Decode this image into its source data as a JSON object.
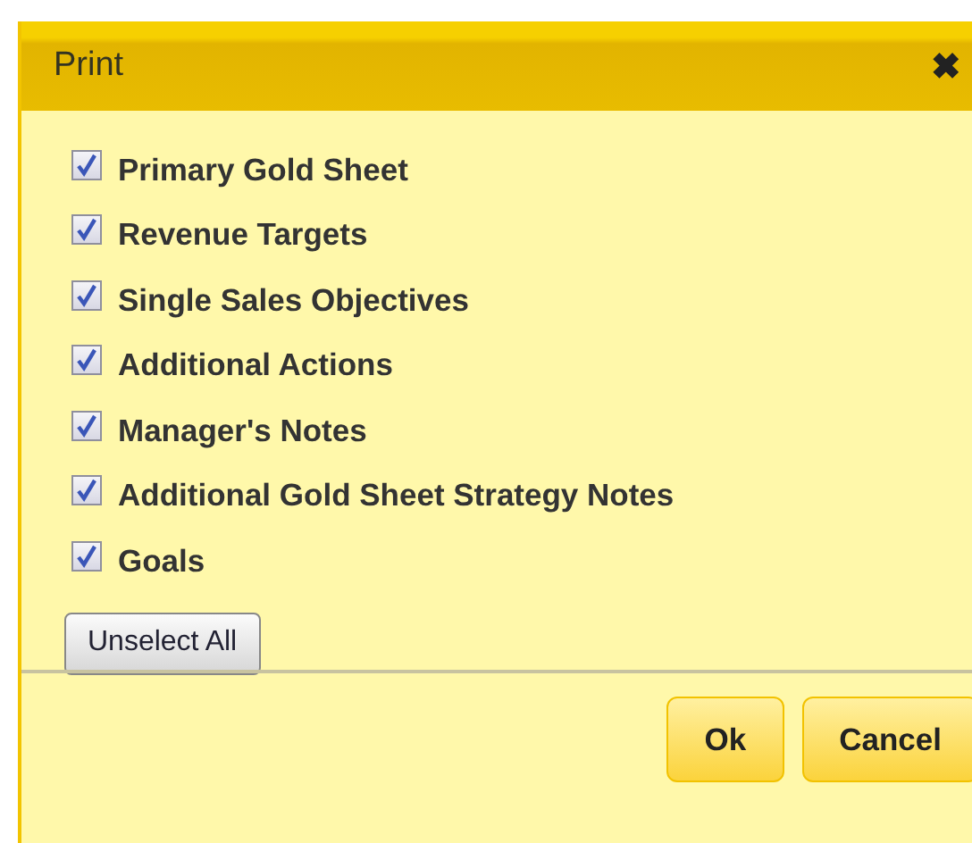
{
  "window": {
    "title": "Print",
    "close": "✖"
  },
  "options": [
    {
      "label": "Primary Gold Sheet",
      "checked": true
    },
    {
      "label": "Revenue Targets",
      "checked": true
    },
    {
      "label": "Single Sales Objectives",
      "checked": true
    },
    {
      "label": "Additional Actions",
      "checked": true
    },
    {
      "label": "Manager's Notes",
      "checked": true
    },
    {
      "label": "Additional Gold Sheet Strategy Notes",
      "checked": true
    },
    {
      "label": "Goals",
      "checked": true
    }
  ],
  "unselect_button": "Unselect All",
  "buttons": [
    "Ok",
    "Cancel"
  ]
}
